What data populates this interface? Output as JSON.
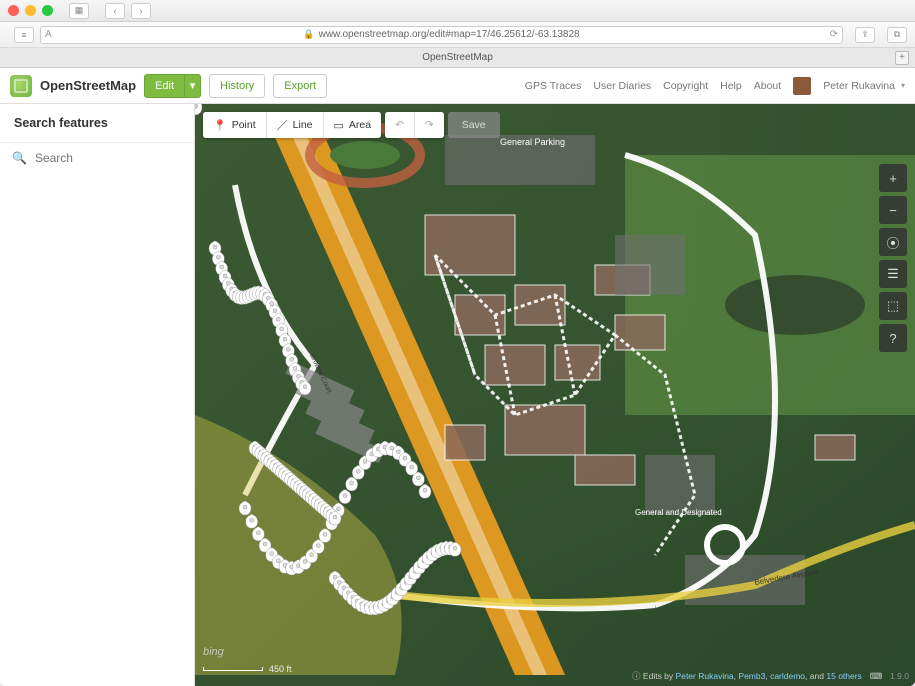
{
  "browser": {
    "url": "www.openstreetmap.org/edit#map=17/46.25612/-63.13828",
    "tab_title": "OpenStreetMap"
  },
  "header": {
    "brand": "OpenStreetMap",
    "edit": "Edit",
    "history": "History",
    "export": "Export",
    "nav": {
      "traces": "GPS Traces",
      "diaries": "User Diaries",
      "copyright": "Copyright",
      "help": "Help",
      "about": "About"
    },
    "user": "Peter Rukavina"
  },
  "sidebar": {
    "title": "Search features",
    "search_placeholder": "Search"
  },
  "editor": {
    "tools": {
      "point": "Point",
      "line": "Line",
      "area": "Area"
    },
    "undo_icon": "↶",
    "redo_icon": "↷",
    "save": "Save"
  },
  "map": {
    "labels": {
      "parking": "General Parking",
      "belvedere": "Belvedere Avenue",
      "browns": "Browns Court",
      "designated": "General and Designated"
    },
    "scale": "450 ft",
    "imagery": "bing",
    "attribution": {
      "prefix": "Edits by",
      "user1": "Peter Rukavina",
      "user2": "Pemb3",
      "user3": "carldemo",
      "suffix_and": "and",
      "others_count": "15",
      "others": "others"
    },
    "version": "1.9.0",
    "center": {
      "lat": 46.25612,
      "lon": -63.13828,
      "zoom": 17
    }
  }
}
